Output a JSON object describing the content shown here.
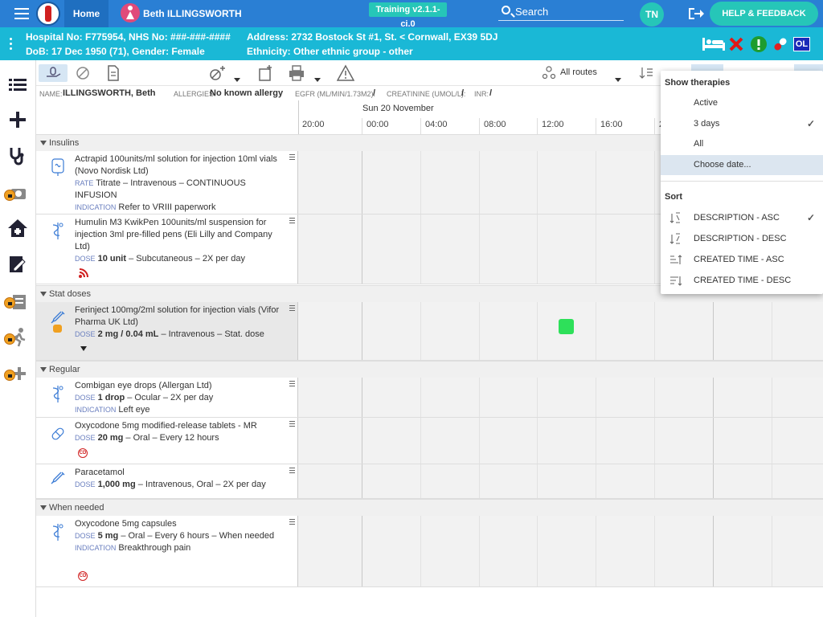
{
  "topbar": {
    "home_label": "Home",
    "patient_name": "Beth ILLINGSWORTH",
    "training_badge": "Training v2.1.1-ci.0",
    "search_label": "Search",
    "user_initials": "TN",
    "help_label": "HELP & FEEDBACK"
  },
  "patient_banner": {
    "hospital_line": "Hospital No: F775954, NHS No: ###-###-####",
    "address_line": "Address: 2732 Bostock St #1, St. < Cornwall, EX39 5DJ",
    "dob_line": "DoB: 17 Dec 1950 (71), Gender: Female",
    "ethnicity_line": "Ethnicity: Other ethnic group - other",
    "user_badge": "OL"
  },
  "toolbar": {
    "routes_label": "All routes"
  },
  "infobar": {
    "name_cap": "NAME:",
    "name_val": "ILLINGSWORTH, Beth",
    "allergies_cap": "ALLERGIES:",
    "allergies_val": "No known allergy",
    "egfr_cap": "EGFR (ML/MIN/1.73M2):",
    "egfr_val": "/",
    "creat_cap": "CREATININE (UMOL/L):",
    "creat_val": "/",
    "inr_cap": "INR:",
    "inr_val": "/"
  },
  "timeline": {
    "date_label": "Sun 20 November",
    "ticks": [
      "20:00",
      "00:00",
      "04:00",
      "08:00",
      "12:00",
      "16:00",
      "2"
    ]
  },
  "sections": {
    "insulins": "Insulins",
    "stat": "Stat doses",
    "regular": "Regular",
    "when_needed": "When needed"
  },
  "meds": [
    {
      "name": "Actrapid 100units/ml solution for injection 10ml vials (Novo Nordisk Ltd)",
      "cap1": "RATE",
      "line1": "Titrate – Intravenous – CONTINUOUS INFUSION",
      "cap2": "INDICATION",
      "line2": "Refer to VRIII paperwork"
    },
    {
      "name": "Humulin M3 KwikPen 100units/ml suspension for injection 3ml pre-filled pens (Eli Lilly and Company Ltd)",
      "cap1": "DOSE",
      "dose": "10 unit",
      "line1": " – Subcutaneous – 2X per day"
    },
    {
      "name": "Ferinject 100mg/2ml solution for injection vials (Vifor Pharma UK Ltd)",
      "cap1": "DOSE",
      "dose": "2 mg / 0.04 mL",
      "line1": " – Intravenous – Stat. dose"
    },
    {
      "name": "Combigan eye drops (Allergan Ltd)",
      "cap1": "DOSE",
      "dose": "1 drop",
      "line1": " – Ocular – 2X per day",
      "cap2": "INDICATION",
      "line2": "Left eye"
    },
    {
      "name": "Oxycodone 5mg modified-release tablets - MR",
      "cap1": "DOSE",
      "dose": "20 mg",
      "line1": " – Oral – Every 12 hours",
      "badge": "CD"
    },
    {
      "name": "Paracetamol",
      "cap1": "DOSE",
      "dose": "1,000 mg",
      "line1": " – Intravenous, Oral – 2X per day"
    },
    {
      "name": "Oxycodone 5mg capsules",
      "cap1": "DOSE",
      "dose": "5 mg",
      "line1": " – Oral – Every 6 hours – When needed",
      "cap2": "INDICATION",
      "line2": "Breakthrough pain",
      "badge": "CD"
    }
  ],
  "dropdown": {
    "show_header": "Show therapies",
    "show_items": [
      "Active",
      "3 days",
      "All",
      "Choose date..."
    ],
    "sort_header": "Sort",
    "sort_items": [
      "DESCRIPTION - ASC",
      "DESCRIPTION - DESC",
      "CREATED TIME - ASC",
      "CREATED TIME - DESC"
    ],
    "check_glyph": "✓"
  },
  "colors": {
    "topbar": "#2a7fd4",
    "patient_banner": "#1ab8d6",
    "accent": "#26c6b8",
    "administered": "#2ee05a",
    "lock": "#f0a020"
  }
}
